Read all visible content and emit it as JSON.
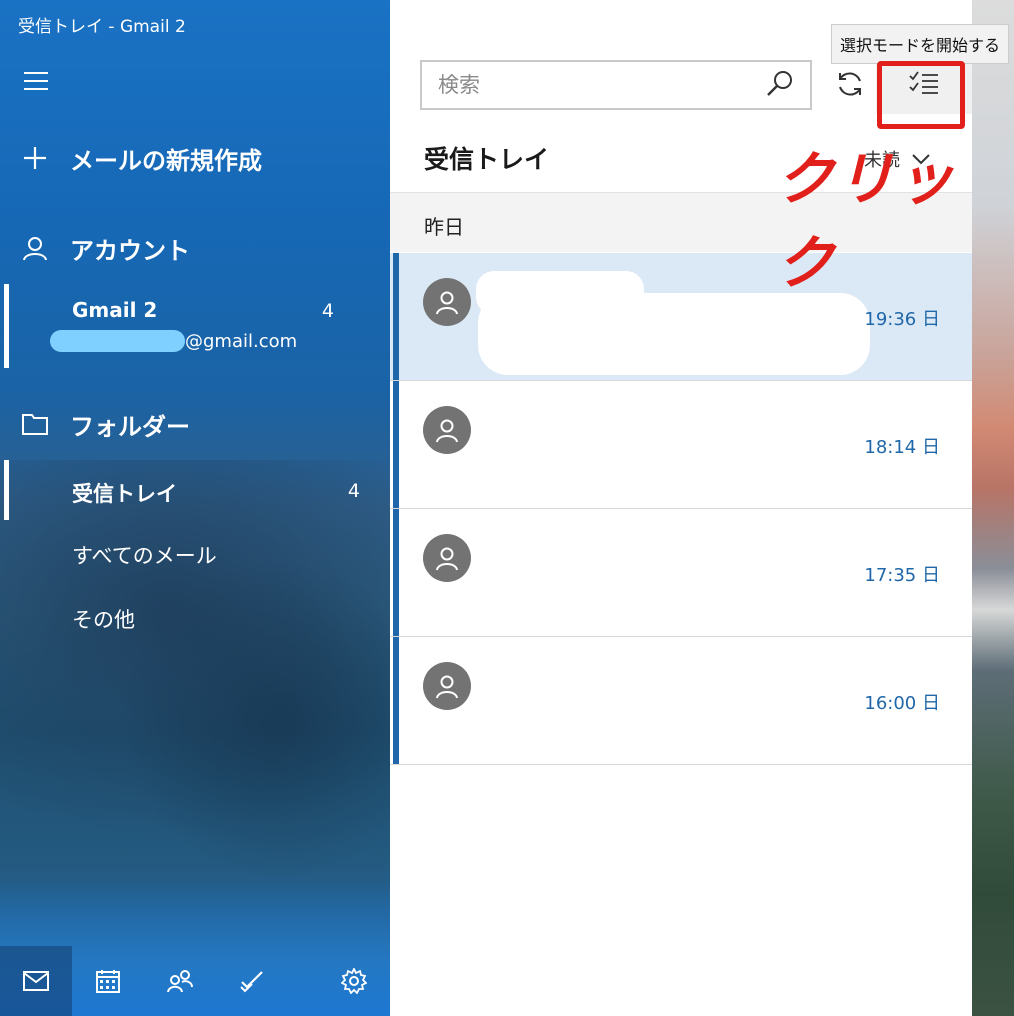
{
  "window": {
    "title": "受信トレイ - Gmail 2"
  },
  "sidebar": {
    "new_mail_label": "メールの新規作成",
    "accounts_label": "アカウント",
    "account": {
      "name": "Gmail 2",
      "count": "4",
      "email_suffix": "@gmail.com"
    },
    "folders_label": "フォルダー",
    "folders": [
      {
        "label": "受信トレイ",
        "count": "4"
      },
      {
        "label": "すべてのメール"
      },
      {
        "label": "その他"
      }
    ]
  },
  "toolbar": {
    "search_placeholder": "検索",
    "tooltip": "選択モードを開始する"
  },
  "list": {
    "title": "受信トレイ",
    "filter_label": "未読",
    "date_header": "昨日",
    "items": [
      {
        "time": "19:36 日"
      },
      {
        "time": "18:14 日"
      },
      {
        "time": "17:35 日"
      },
      {
        "time": "16:00 日"
      }
    ]
  },
  "annotation": {
    "text": "クリック",
    "color": "#e2201b"
  },
  "colors": {
    "accent": "#1f67a8",
    "sidebar": "#1a6ec0",
    "selected_row": "#dbe9f6"
  }
}
